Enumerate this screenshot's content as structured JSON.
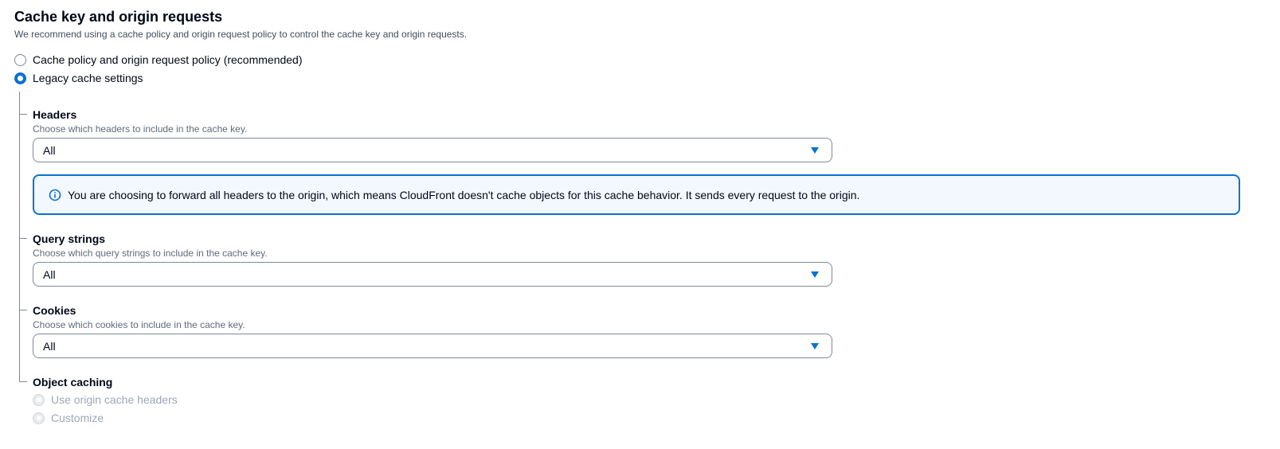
{
  "section": {
    "title": "Cache key and origin requests",
    "description": "We recommend using a cache policy and origin request policy to control the cache key and origin requests."
  },
  "mode_options": [
    {
      "label": "Cache policy and origin request policy (recommended)",
      "selected": false
    },
    {
      "label": "Legacy cache settings",
      "selected": true
    }
  ],
  "headers": {
    "label": "Headers",
    "description": "Choose which headers to include in the cache key.",
    "value": "All"
  },
  "alert": {
    "icon": "info-icon",
    "text": "You are choosing to forward all headers to the origin, which means CloudFront doesn't cache objects for this cache behavior. It sends every request to the origin."
  },
  "query_strings": {
    "label": "Query strings",
    "description": "Choose which query strings to include in the cache key.",
    "value": "All"
  },
  "cookies": {
    "label": "Cookies",
    "description": "Choose which cookies to include in the cache key.",
    "value": "All"
  },
  "object_caching": {
    "label": "Object caching",
    "options": [
      {
        "label": "Use origin cache headers",
        "disabled": true
      },
      {
        "label": "Customize",
        "disabled": true
      }
    ]
  },
  "colors": {
    "accent": "#0972d3",
    "alert_background": "#f2f8fd",
    "disabled_text": "#9ba7b6"
  }
}
